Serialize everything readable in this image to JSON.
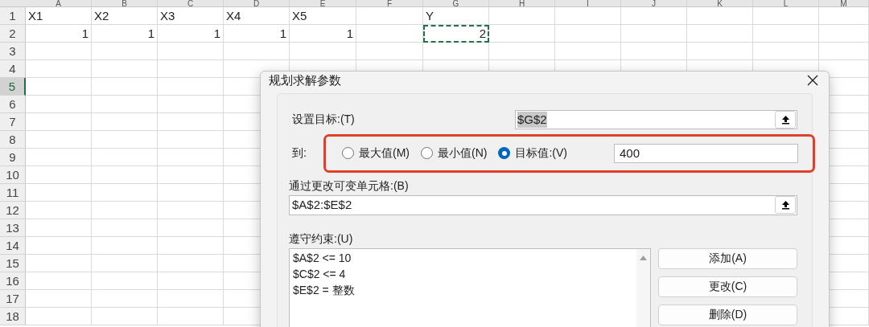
{
  "sheet": {
    "columns": [
      "A",
      "B",
      "C",
      "D",
      "E",
      "F",
      "G",
      "H",
      "I",
      "J",
      "K",
      "L",
      "M"
    ],
    "rows": [
      {
        "header": "1",
        "selected": false,
        "cells": {
          "A": {
            "text": "X1",
            "kind": "text",
            "selected": false
          },
          "B": {
            "text": "X2",
            "kind": "text",
            "selected": false
          },
          "C": {
            "text": "X3",
            "kind": "text",
            "selected": false
          },
          "D": {
            "text": "X4",
            "kind": "text",
            "selected": false
          },
          "E": {
            "text": "X5",
            "kind": "text",
            "selected": false
          },
          "G": {
            "text": "Y",
            "kind": "text",
            "selected": false
          }
        }
      },
      {
        "header": "2",
        "selected": false,
        "cells": {
          "A": {
            "text": "1",
            "kind": "number",
            "selected": false
          },
          "B": {
            "text": "1",
            "kind": "number",
            "selected": false
          },
          "C": {
            "text": "1",
            "kind": "number",
            "selected": false
          },
          "D": {
            "text": "1",
            "kind": "number",
            "selected": false
          },
          "E": {
            "text": "1",
            "kind": "number",
            "selected": false
          },
          "G": {
            "text": "2",
            "kind": "number",
            "selected": true
          }
        }
      },
      {
        "header": "3",
        "selected": false
      },
      {
        "header": "4",
        "selected": false
      },
      {
        "header": "5",
        "selected": true
      },
      {
        "header": "6",
        "selected": false
      },
      {
        "header": "7",
        "selected": false
      },
      {
        "header": "8",
        "selected": false
      },
      {
        "header": "9",
        "selected": false
      },
      {
        "header": "10",
        "selected": false
      },
      {
        "header": "11",
        "selected": false
      },
      {
        "header": "12",
        "selected": false
      },
      {
        "header": "13",
        "selected": false
      },
      {
        "header": "14",
        "selected": false
      },
      {
        "header": "15",
        "selected": false
      },
      {
        "header": "16",
        "selected": false
      },
      {
        "header": "17",
        "selected": false
      },
      {
        "header": "18",
        "selected": false
      }
    ]
  },
  "dialog": {
    "title": "规划求解参数",
    "target": {
      "label": "设置目标:(T)",
      "value": "$G$2",
      "text_selected": true
    },
    "to": {
      "label": "到:",
      "options": [
        {
          "label": "最大值(M)",
          "selected": false
        },
        {
          "label": "最小值(N)",
          "selected": false
        },
        {
          "label": "目标值:(V)",
          "selected": true
        }
      ],
      "value": "400"
    },
    "changing_cells": {
      "label": "通过更改可变单元格:(B)",
      "value": "$A$2:$E$2"
    },
    "constraints": {
      "label": "遵守约束:(U)",
      "items": [
        "$A$2 <= 10",
        "$C$2 <= 4",
        "$E$2 = 整数"
      ]
    },
    "buttons": [
      "添加(A)",
      "更改(C)",
      "删除(D)"
    ]
  }
}
